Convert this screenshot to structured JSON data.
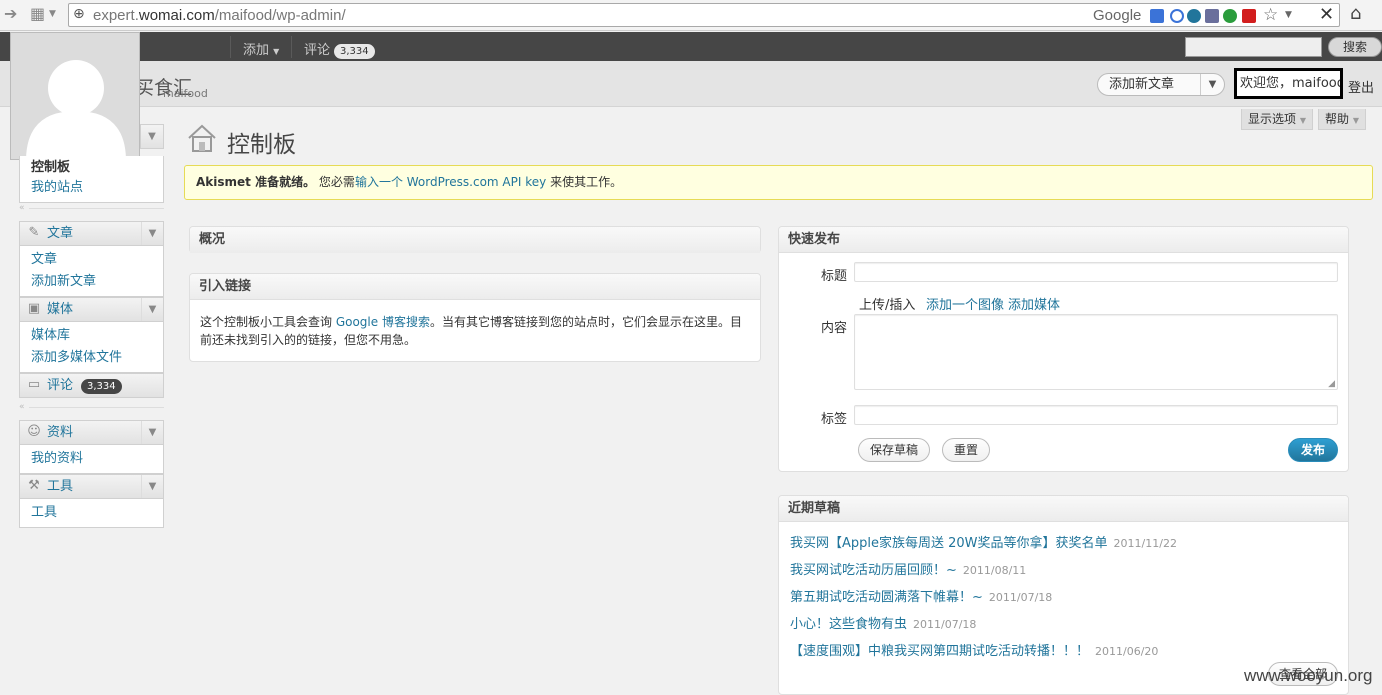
{
  "browser": {
    "url_prefix": "expert.",
    "url_domain": "womai.com",
    "url_path": "/maifood/wp-admin/",
    "search_engine": "Google"
  },
  "adminbar": {
    "add_label": "添加",
    "comments_label": "评论",
    "comments_count": "3,334",
    "search_button": "搜索"
  },
  "header": {
    "site_title": "买食汇",
    "site_sub": "maifood",
    "favorite_action": "添加新文章",
    "welcome": "欢迎您，maifood",
    "logout": "登出"
  },
  "screen": {
    "options": "显示选项",
    "help": "帮助"
  },
  "sidebar": {
    "dashboard": "控制板",
    "my_sites": "我的站点",
    "posts": {
      "label": "文章",
      "items": [
        "文章",
        "添加新文章"
      ]
    },
    "media": {
      "label": "媒体",
      "items": [
        "媒体库",
        "添加多媒体文件"
      ]
    },
    "comments": {
      "label": "评论",
      "count": "3,334"
    },
    "profile": {
      "label": "资料",
      "items": [
        "我的资料"
      ]
    },
    "tools": {
      "label": "工具",
      "items": [
        "工具"
      ]
    }
  },
  "page": {
    "title": "控制板"
  },
  "notice": {
    "bold": "Akismet 准备就绪。",
    "text1": "您必需",
    "link": "输入一个 WordPress.com API key",
    "text2": "来使其工作。"
  },
  "right_now": {
    "title": "概况"
  },
  "incoming_links": {
    "title": "引入链接",
    "text1": "这个控制板小工具会查询 ",
    "link": "Google 博客搜索",
    "text2": "。当有其它博客链接到您的站点时，它们会显示在这里。目前还未找到引入的的链接，但您不用急。"
  },
  "quick_press": {
    "title": "快速发布",
    "title_label": "标题",
    "upload_label": "上传/插入",
    "add_image": "添加一个图像",
    "add_media": "添加媒体",
    "content_label": "内容",
    "tags_label": "标签",
    "save_draft": "保存草稿",
    "reset": "重置",
    "publish": "发布"
  },
  "recent_drafts": {
    "title": "近期草稿",
    "items": [
      {
        "title": "我买网【Apple家族每周送 20W奖品等你拿】获奖名单",
        "date": "2011/11/22"
      },
      {
        "title": "我买网试吃活动历届回顾！~",
        "date": "2011/08/11"
      },
      {
        "title": "第五期试吃活动圆满落下帷幕！~",
        "date": "2011/07/18"
      },
      {
        "title": "小心！这些食物有虫",
        "date": "2011/07/18"
      },
      {
        "title": "【速度围观】中粮我买网第四期试吃活动转播！！！",
        "date": "2011/06/20"
      }
    ],
    "view_all": "查看全部"
  },
  "watermark": "www.wooyun.org",
  "colors": {
    "link": "#21759b",
    "adminbar": "#464646",
    "notice_bg": "#ffffe0",
    "publish": "#21759b"
  }
}
